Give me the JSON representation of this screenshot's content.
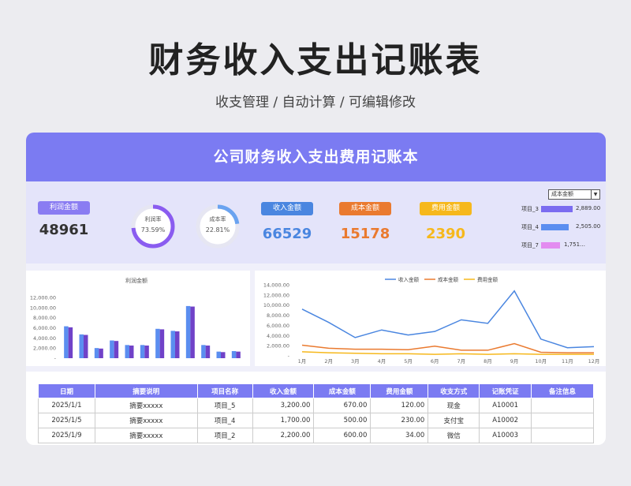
{
  "page": {
    "title": "财务收入支出记账表",
    "subtitle": "收支管理 / 自动计算 / 可编辑修改"
  },
  "card": {
    "header": "公司财务收入支出费用记账本"
  },
  "kpis": {
    "profit": {
      "label": "利润金额",
      "value": "48961"
    },
    "profit_rate": {
      "label": "利润率",
      "value": "73.59%",
      "fraction": 0.7359
    },
    "cost_rate": {
      "label": "成本率",
      "value": "22.81%",
      "fraction": 0.2281
    },
    "income": {
      "label": "收入金额",
      "value": "66529"
    },
    "cost": {
      "label": "成本金额",
      "value": "15178"
    },
    "expense": {
      "label": "费用金额",
      "value": "2390"
    }
  },
  "colors": {
    "accent": "#7b7bf2",
    "income": "#4a86e0",
    "cost": "#ea7a2f",
    "expense": "#f6b81c",
    "profit_label": "#8a7cf2"
  },
  "ranking": {
    "dropdown_value": "成本金额",
    "items": [
      {
        "label": "项目_3",
        "value": "2,889.00",
        "amount": 2889,
        "color": "#7b6cf0"
      },
      {
        "label": "项目_4",
        "value": "2,505.00",
        "amount": 2505,
        "color": "#5b8ef0"
      },
      {
        "label": "项目_7",
        "value": "1,751…",
        "amount": 1751,
        "color": "#e38cf0"
      }
    ]
  },
  "chart_data": [
    {
      "type": "bar",
      "title": "利润金额",
      "ylim": [
        0,
        12000
      ],
      "yticks": [
        "12,000.00",
        "10,000.00",
        "8,000.00",
        "6,000.00",
        "4,000.00",
        "2,000.00",
        "-"
      ],
      "series": [
        {
          "values": [
            6300,
            4700,
            2000,
            3500,
            2600,
            2600,
            5800,
            5400,
            10300,
            2600,
            1300,
            1400
          ]
        },
        {
          "values": [
            6100,
            4600,
            1900,
            3400,
            2500,
            2500,
            5700,
            5300,
            10200,
            2500,
            1200,
            1300
          ]
        }
      ],
      "grid": false
    },
    {
      "type": "line",
      "categories": [
        "1月",
        "2月",
        "3月",
        "4月",
        "5月",
        "6月",
        "7月",
        "8月",
        "9月",
        "10月",
        "11月",
        "12月"
      ],
      "ylim": [
        0,
        14000
      ],
      "yticks": [
        "14,000.00",
        "12,000.00",
        "10,000.00",
        "8,000.00",
        "6,000.00",
        "4,000.00",
        "2,000.00",
        "-"
      ],
      "legend_position": "top",
      "series": [
        {
          "name": "收入金额",
          "color": "#4a86e0",
          "values": [
            9200,
            6600,
            3600,
            5100,
            4100,
            4800,
            7100,
            6400,
            12800,
            3300,
            1600,
            1800
          ]
        },
        {
          "name": "成本金额",
          "color": "#ea7a2f",
          "values": [
            2100,
            1500,
            1300,
            1300,
            1200,
            1900,
            1100,
            1100,
            2400,
            700,
            600,
            600
          ]
        },
        {
          "name": "费用金额",
          "color": "#f6b81c",
          "values": [
            800,
            600,
            500,
            400,
            400,
            300,
            400,
            300,
            400,
            300,
            300,
            300
          ]
        }
      ],
      "grid": false
    }
  ],
  "table": {
    "headers": [
      "日期",
      "摘要说明",
      "项目名称",
      "收入金额",
      "成本金额",
      "费用金额",
      "收支方式",
      "记账凭证",
      "备注信息"
    ],
    "rows": [
      [
        "2025/1/1",
        "摘要xxxxx",
        "项目_5",
        "3,200.00",
        "670.00",
        "120.00",
        "现金",
        "A10001",
        ""
      ],
      [
        "2025/1/5",
        "摘要xxxxx",
        "项目_4",
        "1,700.00",
        "500.00",
        "230.00",
        "支付宝",
        "A10002",
        ""
      ],
      [
        "2025/1/9",
        "摘要xxxxx",
        "项目_2",
        "2,200.00",
        "600.00",
        "34.00",
        "微信",
        "A10003",
        ""
      ]
    ]
  }
}
